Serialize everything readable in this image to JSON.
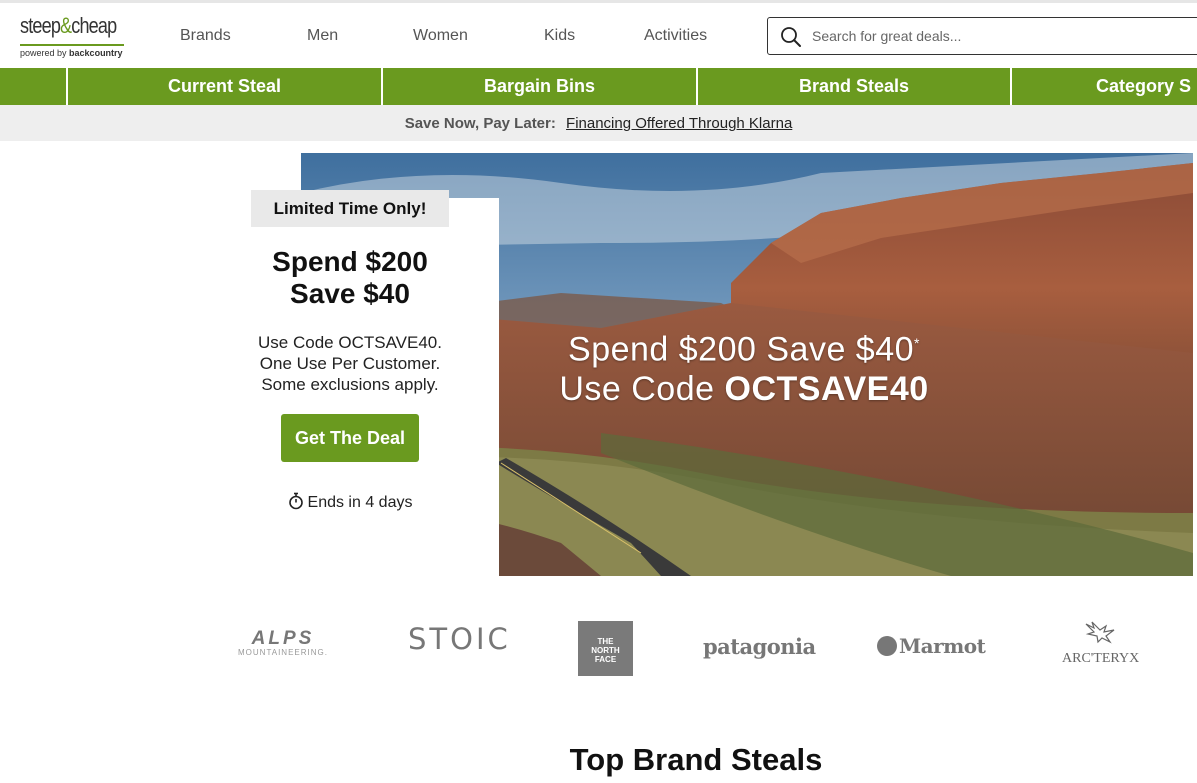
{
  "brand": {
    "logo_text_a": "steep",
    "logo_text_amp": "&",
    "logo_text_b": "cheap",
    "tagline_a": "powered by",
    "tagline_b": "backcountry",
    "accent_color": "#6a9a1f"
  },
  "nav": {
    "items": [
      "Brands",
      "Men",
      "Women",
      "Kids",
      "Activities"
    ]
  },
  "search": {
    "placeholder": "Search for great deals...",
    "value": ""
  },
  "categories": {
    "items": [
      "Current Steal",
      "Bargain Bins",
      "Brand Steals",
      "Category S"
    ]
  },
  "promo": {
    "lead": "Save Now, Pay Later:",
    "link": "Financing Offered Through Klarna"
  },
  "deal": {
    "badge": "Limited Time Only!",
    "headline_line1": "Spend $200",
    "headline_line2": "Save $40",
    "desc_line1": "Use Code OCTSAVE40.",
    "desc_line2": "One Use Per Customer.",
    "desc_line3": "Some exclusions apply.",
    "cta": "Get The Deal",
    "timer": "Ends in 4 days"
  },
  "hero": {
    "line1": "Spend $200 Save $40",
    "line1_mark": "*",
    "line2_prefix": "Use Code",
    "line2_code": "OCTSAVE40"
  },
  "brands": {
    "alps_big": "ALPS",
    "alps_small": "MOUNTAINEERING.",
    "stoic": "STOIC",
    "tnf_line1": "THE",
    "tnf_line2": "NORTH",
    "tnf_line3": "FACE",
    "patagonia": "patagonia",
    "marmot": "Marmot",
    "arcteryx": "ARC'TERYX"
  },
  "section": {
    "title": "Top Brand Steals"
  }
}
